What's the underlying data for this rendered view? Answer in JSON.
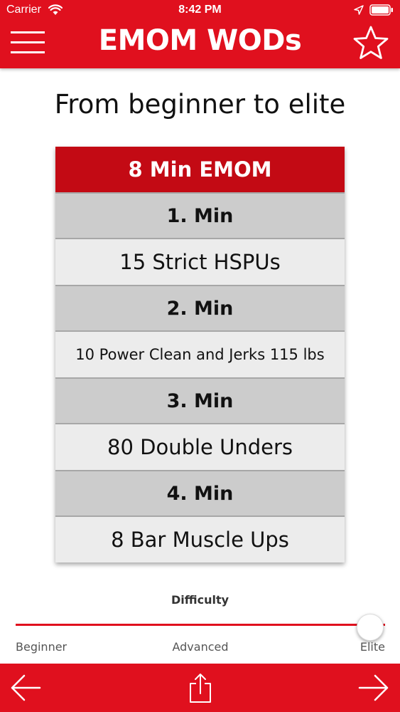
{
  "status_bar": {
    "carrier": "Carrier",
    "time": "8:42 PM"
  },
  "nav": {
    "title": "EMOM WODs",
    "menu_icon": "hamburger-menu-icon",
    "favorite_icon": "star-icon"
  },
  "subtitle": "From beginner to elite",
  "workout": {
    "header": "8 Min EMOM",
    "rows": [
      {
        "minute": "1. Min",
        "exercise": "15 Strict HSPUs"
      },
      {
        "minute": "2. Min",
        "exercise": "10 Power Clean and Jerks 115 lbs"
      },
      {
        "minute": "3. Min",
        "exercise": "80 Double Unders"
      },
      {
        "minute": "4. Min",
        "exercise": "8 Bar Muscle Ups"
      }
    ]
  },
  "difficulty": {
    "label": "Difficulty",
    "levels": [
      "Beginner",
      "Advanced",
      "Elite"
    ],
    "value_fraction": 0.96
  },
  "bottom_bar": {
    "back_icon": "arrow-left-icon",
    "share_icon": "share-icon",
    "forward_icon": "arrow-right-icon"
  },
  "colors": {
    "brand_red": "#e0101e",
    "header_red": "#c30a14",
    "minute_row": "#cccccc",
    "exercise_row": "#ececec"
  }
}
